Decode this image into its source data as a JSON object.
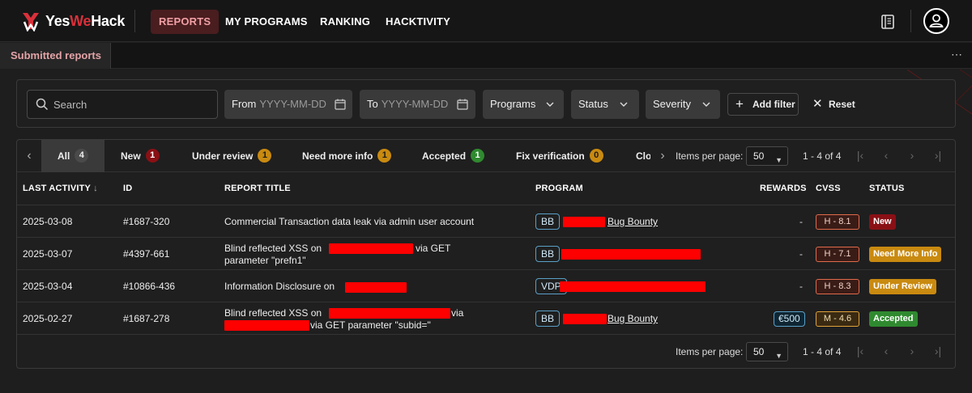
{
  "brand": {
    "name_a": "Yes",
    "name_b": "We",
    "name_c": "Hack"
  },
  "nav": {
    "items": [
      "REPORTS",
      "MY PROGRAMS",
      "RANKING",
      "HACKTIVITY"
    ]
  },
  "subtab": "Submitted reports",
  "more": "⋯",
  "filters": {
    "search_placeholder": "Search",
    "from_label": "From",
    "from_placeholder": "YYYY-MM-DD",
    "to_label": "To",
    "to_placeholder": "YYYY-MM-DD",
    "programs": "Programs",
    "status": "Status",
    "severity": "Severity",
    "add_filter": "Add filter",
    "reset": "Reset"
  },
  "tabs": [
    {
      "label": "All",
      "count": "4",
      "color": "#4a4a4a",
      "textcolor": "#eee"
    },
    {
      "label": "New",
      "count": "1",
      "color": "#8a1015",
      "textcolor": "#fff"
    },
    {
      "label": "Under review",
      "count": "1",
      "color": "#c98a10",
      "textcolor": "#1a1a1a"
    },
    {
      "label": "Need more info",
      "count": "1",
      "color": "#c98a10",
      "textcolor": "#1a1a1a"
    },
    {
      "label": "Accepted",
      "count": "1",
      "color": "#2f8a2f",
      "textcolor": "#fff"
    },
    {
      "label": "Fix verification",
      "count": "0",
      "color": "#c98a10",
      "textcolor": "#1a1a1a"
    },
    {
      "label": "Clo",
      "count": "",
      "color": "",
      "textcolor": ""
    }
  ],
  "pager": {
    "items_per_page_label": "Items per page:",
    "items_per_page": "50",
    "range": "1 - 4 of 4"
  },
  "columns": {
    "last_activity": "LAST ACTIVITY",
    "sort_arrow": "↓",
    "id": "ID",
    "title": "REPORT TITLE",
    "program": "PROGRAM",
    "rewards": "REWARDS",
    "cvss": "CVSS",
    "status": "STATUS"
  },
  "rows": [
    {
      "date": "2025-03-08",
      "id": "#1687-320",
      "title_a": "Commercial Transaction data leak via admin user account",
      "prog_type": "BB",
      "prog_name": "Bug Bounty",
      "reward": "-",
      "cvss": "H - 8.1",
      "cvss_level": "high",
      "status": "New",
      "status_color": "#8a1015"
    },
    {
      "date": "2025-03-07",
      "id": "#4397-661",
      "title_a": "Blind reflected XSS on",
      "title_b": "via GET",
      "title_c": "parameter \"prefn1\"",
      "prog_type": "BB",
      "prog_name": "",
      "reward": "-",
      "cvss": "H - 7.1",
      "cvss_level": "high",
      "status": "Need More Info",
      "status_color": "#c98a10"
    },
    {
      "date": "2025-03-04",
      "id": "#10866-436",
      "title_a": "Information Disclosure on",
      "prog_type": "VDP",
      "prog_name": "",
      "reward": "-",
      "cvss": "H - 8.3",
      "cvss_level": "high",
      "status": "Under Review",
      "status_color": "#c98a10"
    },
    {
      "date": "2025-02-27",
      "id": "#1687-278",
      "title_a": "Blind reflected XSS on",
      "title_b": "via",
      "title_c": "via GET parameter \"subid=\"",
      "prog_type": "BB",
      "prog_name": "Bug Bounty",
      "reward": "€500",
      "cvss": "M - 4.6",
      "cvss_level": "med",
      "status": "Accepted",
      "status_color": "#2f8a2f"
    }
  ]
}
